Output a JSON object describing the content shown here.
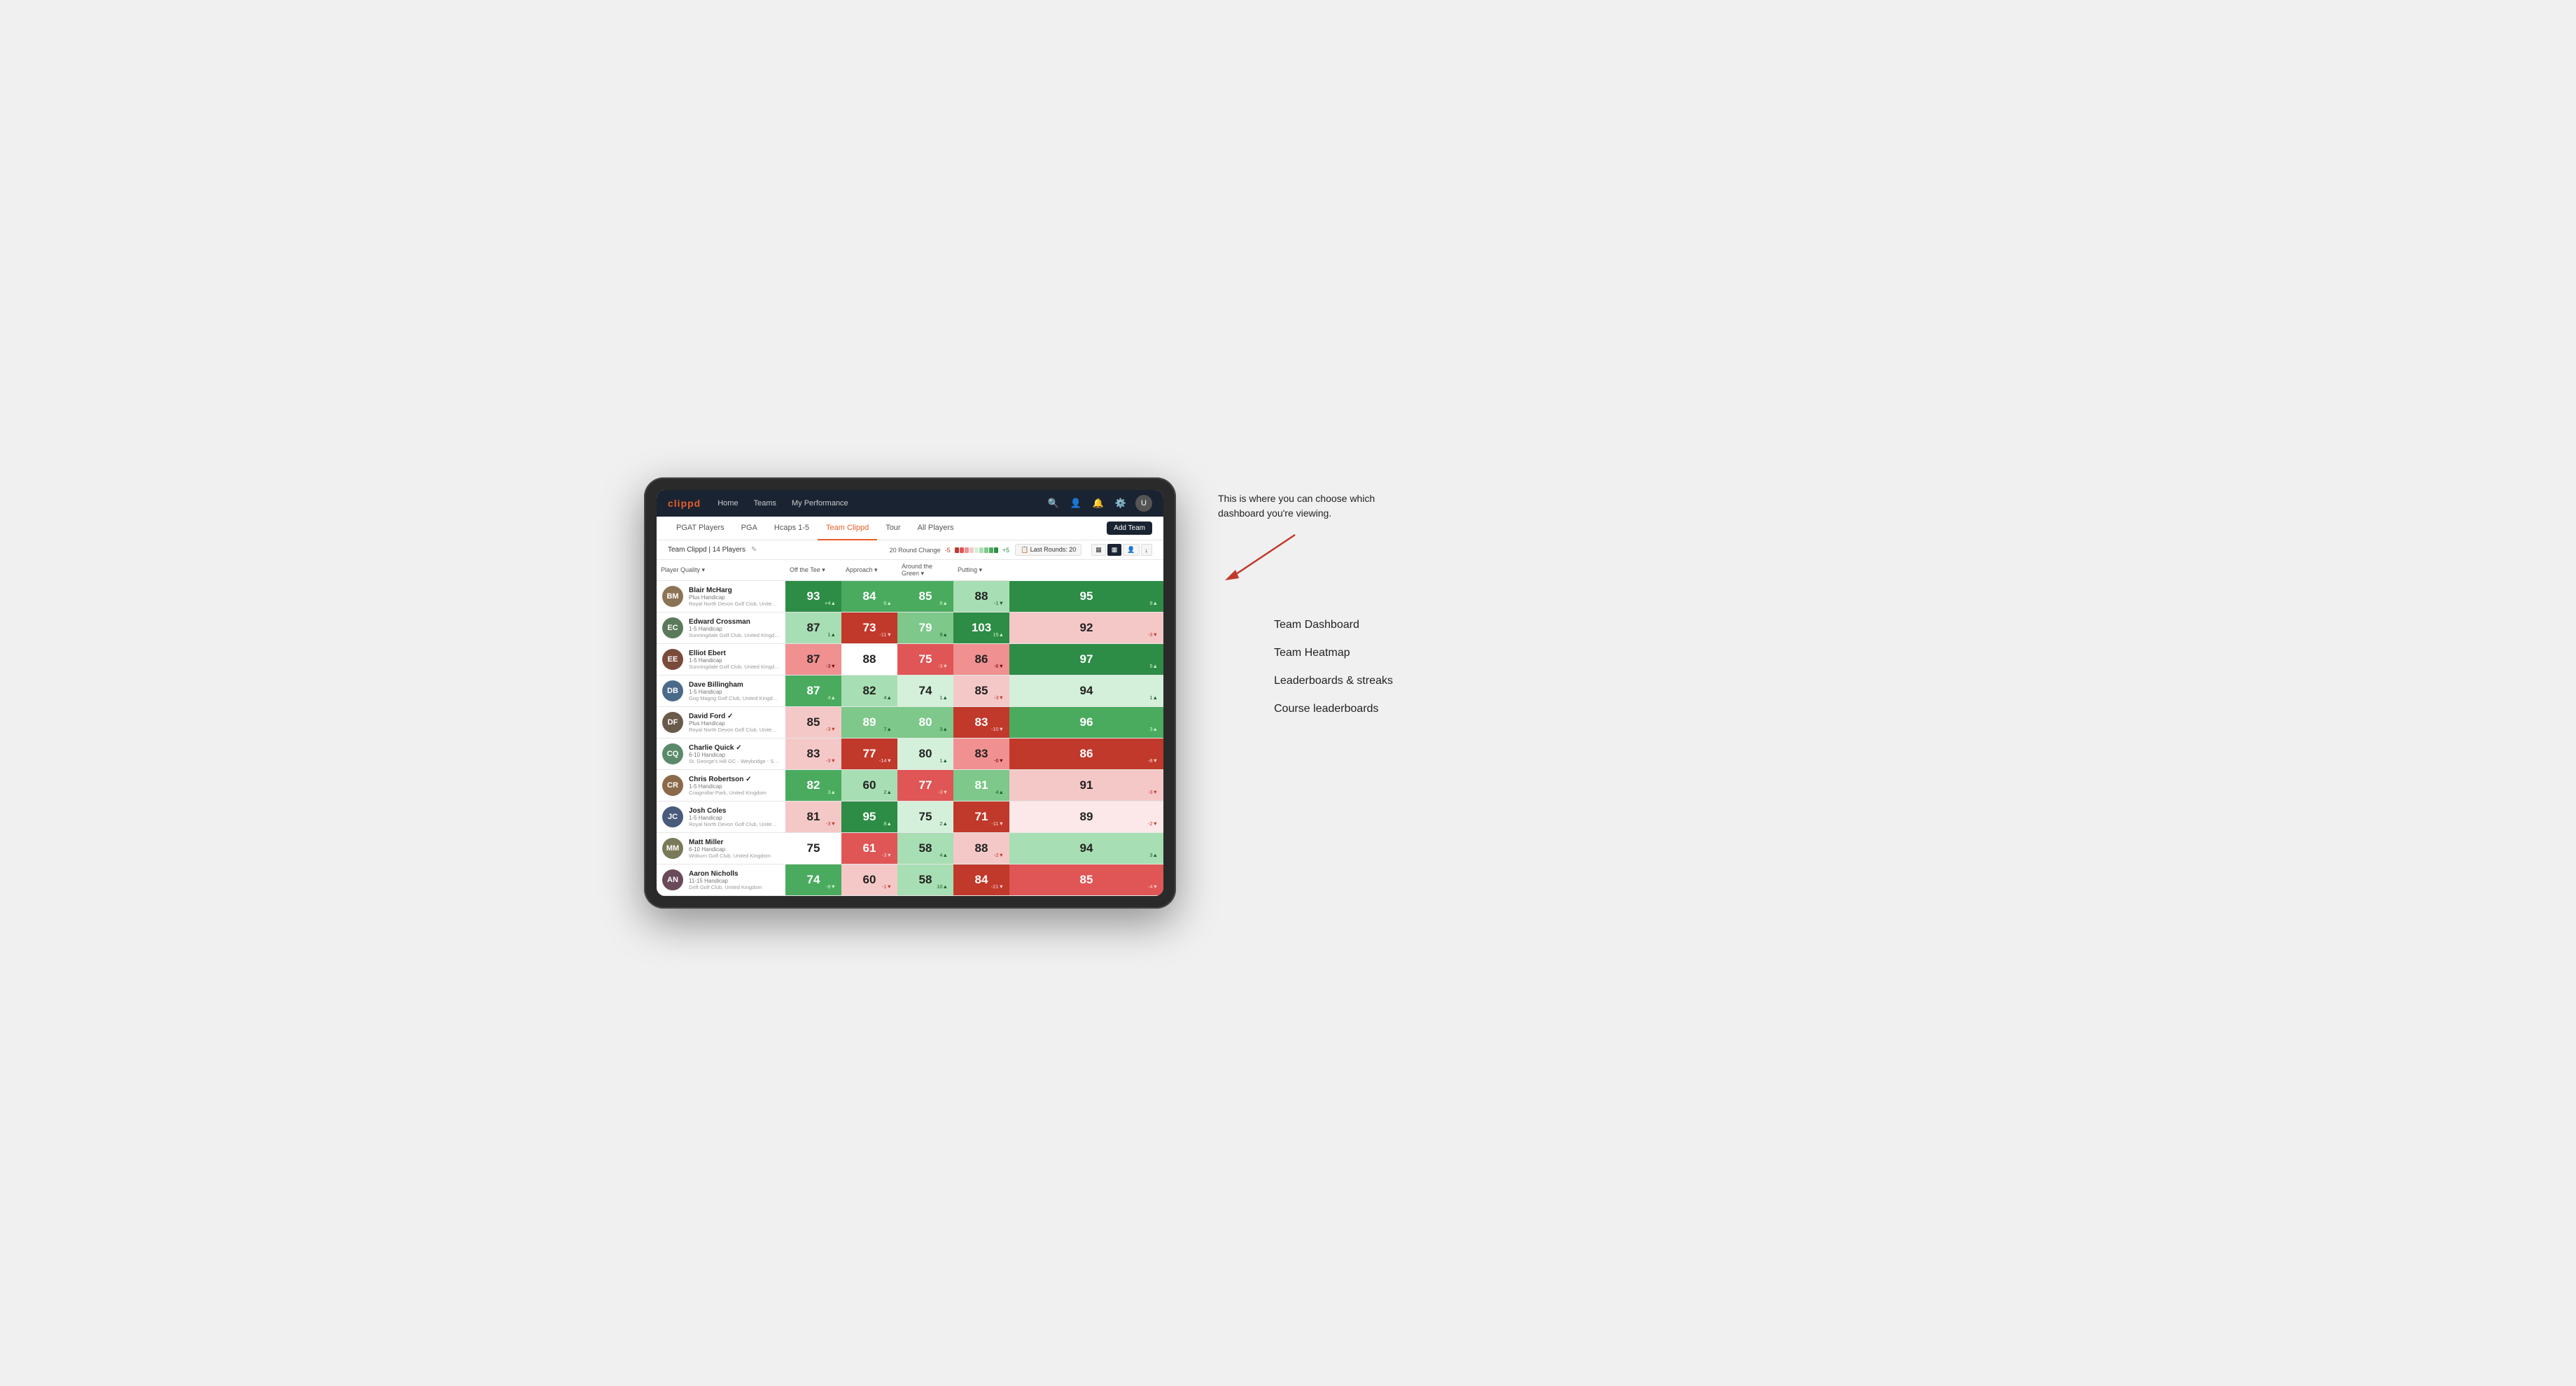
{
  "annotation": {
    "intro_text": "This is where you can choose which dashboard you're viewing.",
    "options": [
      "Team Dashboard",
      "Team Heatmap",
      "Leaderboards & streaks",
      "Course leaderboards"
    ]
  },
  "nav": {
    "logo": "clippd",
    "links": [
      "Home",
      "Teams",
      "My Performance"
    ],
    "icons": [
      "search",
      "user",
      "bell",
      "settings",
      "avatar"
    ]
  },
  "sub_nav": {
    "items": [
      "PGAT Players",
      "PGA",
      "Hcaps 1-5",
      "Team Clippd",
      "Tour",
      "All Players"
    ],
    "active": "Team Clippd",
    "add_button": "Add Team"
  },
  "team_bar": {
    "team_name": "Team Clippd",
    "player_count": "14 Players",
    "round_change_label": "20 Round Change",
    "round_change_neg": "-5",
    "round_change_pos": "+5",
    "last_rounds_label": "Last Rounds:",
    "last_rounds_value": "20"
  },
  "table": {
    "headers": {
      "player": "Player Quality ▾",
      "off_tee": "Off the Tee ▾",
      "approach": "Approach ▾",
      "around_green": "Around the Green ▾",
      "putting": "Putting ▾"
    },
    "players": [
      {
        "name": "Blair McHarg",
        "handicap": "Plus Handicap",
        "club": "Royal North Devon Golf Club, United Kingdom",
        "initials": "BM",
        "avatar_color": "#8B7355",
        "scores": {
          "quality": {
            "val": 93,
            "change": "+4",
            "dir": "up",
            "bg": "green-dark"
          },
          "off_tee": {
            "val": 84,
            "change": "6",
            "dir": "up",
            "bg": "green-mid"
          },
          "approach": {
            "val": 85,
            "change": "8",
            "dir": "up",
            "bg": "green-mid"
          },
          "around_green": {
            "val": 88,
            "change": "-1",
            "dir": "down",
            "bg": "green-pale"
          },
          "putting": {
            "val": 95,
            "change": "9",
            "dir": "up",
            "bg": "green-dark"
          }
        }
      },
      {
        "name": "Edward Crossman",
        "handicap": "1-5 Handicap",
        "club": "Sunningdale Golf Club, United Kingdom",
        "initials": "EC",
        "avatar_color": "#5a7a5a",
        "scores": {
          "quality": {
            "val": 87,
            "change": "1",
            "dir": "up",
            "bg": "green-pale"
          },
          "off_tee": {
            "val": 73,
            "change": "-11",
            "dir": "down",
            "bg": "red-dark"
          },
          "approach": {
            "val": 79,
            "change": "9",
            "dir": "up",
            "bg": "green-light"
          },
          "around_green": {
            "val": 103,
            "change": "15",
            "dir": "up",
            "bg": "green-dark"
          },
          "putting": {
            "val": 92,
            "change": "-3",
            "dir": "down",
            "bg": "red-pale"
          }
        }
      },
      {
        "name": "Elliot Ebert",
        "handicap": "1-5 Handicap",
        "club": "Sunningdale Golf Club, United Kingdom",
        "initials": "EE",
        "avatar_color": "#7a4a3a",
        "scores": {
          "quality": {
            "val": 87,
            "change": "-3",
            "dir": "down",
            "bg": "red-light"
          },
          "off_tee": {
            "val": 88,
            "change": "",
            "dir": "neutral",
            "bg": "white"
          },
          "approach": {
            "val": 75,
            "change": "-3",
            "dir": "down",
            "bg": "red-mid"
          },
          "around_green": {
            "val": 86,
            "change": "-6",
            "dir": "down",
            "bg": "red-light"
          },
          "putting": {
            "val": 97,
            "change": "5",
            "dir": "up",
            "bg": "green-dark"
          }
        }
      },
      {
        "name": "Dave Billingham",
        "handicap": "1-5 Handicap",
        "club": "Gog Magog Golf Club, United Kingdom",
        "initials": "DB",
        "avatar_color": "#4a6a8a",
        "scores": {
          "quality": {
            "val": 87,
            "change": "4",
            "dir": "up",
            "bg": "green-mid"
          },
          "off_tee": {
            "val": 82,
            "change": "4",
            "dir": "up",
            "bg": "green-pale"
          },
          "approach": {
            "val": 74,
            "change": "1",
            "dir": "up",
            "bg": "green-very-pale"
          },
          "around_green": {
            "val": 85,
            "change": "-3",
            "dir": "down",
            "bg": "red-pale"
          },
          "putting": {
            "val": 94,
            "change": "1",
            "dir": "up",
            "bg": "green-very-pale"
          }
        }
      },
      {
        "name": "David Ford",
        "handicap": "Plus Handicap",
        "club": "Royal North Devon Golf Club, United Kingdom",
        "initials": "DF",
        "avatar_color": "#6a5a4a",
        "verified": true,
        "scores": {
          "quality": {
            "val": 85,
            "change": "-3",
            "dir": "down",
            "bg": "red-pale"
          },
          "off_tee": {
            "val": 89,
            "change": "7",
            "dir": "up",
            "bg": "green-light"
          },
          "approach": {
            "val": 80,
            "change": "3",
            "dir": "up",
            "bg": "green-light"
          },
          "around_green": {
            "val": 83,
            "change": "-10",
            "dir": "down",
            "bg": "red-dark"
          },
          "putting": {
            "val": 96,
            "change": "3",
            "dir": "up",
            "bg": "green-mid"
          }
        }
      },
      {
        "name": "Charlie Quick",
        "handicap": "6-10 Handicap",
        "club": "St. George's Hill GC - Weybridge - Surrey, Uni...",
        "initials": "CQ",
        "avatar_color": "#5a8a6a",
        "verified": true,
        "scores": {
          "quality": {
            "val": 83,
            "change": "-3",
            "dir": "down",
            "bg": "red-pale"
          },
          "off_tee": {
            "val": 77,
            "change": "-14",
            "dir": "down",
            "bg": "red-dark"
          },
          "approach": {
            "val": 80,
            "change": "1",
            "dir": "up",
            "bg": "green-very-pale"
          },
          "around_green": {
            "val": 83,
            "change": "-6",
            "dir": "down",
            "bg": "red-light"
          },
          "putting": {
            "val": 86,
            "change": "-8",
            "dir": "down",
            "bg": "red-dark"
          }
        }
      },
      {
        "name": "Chris Robertson",
        "handicap": "1-5 Handicap",
        "club": "Craigmillar Park, United Kingdom",
        "initials": "CR",
        "avatar_color": "#8a6a4a",
        "verified": true,
        "scores": {
          "quality": {
            "val": 82,
            "change": "3",
            "dir": "up",
            "bg": "green-mid"
          },
          "off_tee": {
            "val": 60,
            "change": "2",
            "dir": "up",
            "bg": "green-pale"
          },
          "approach": {
            "val": 77,
            "change": "-3",
            "dir": "down",
            "bg": "red-mid"
          },
          "around_green": {
            "val": 81,
            "change": "4",
            "dir": "up",
            "bg": "green-light"
          },
          "putting": {
            "val": 91,
            "change": "-3",
            "dir": "down",
            "bg": "red-pale"
          }
        }
      },
      {
        "name": "Josh Coles",
        "handicap": "1-5 Handicap",
        "club": "Royal North Devon Golf Club, United Kingdom",
        "initials": "JC",
        "avatar_color": "#4a5a7a",
        "scores": {
          "quality": {
            "val": 81,
            "change": "-3",
            "dir": "down",
            "bg": "red-pale"
          },
          "off_tee": {
            "val": 95,
            "change": "8",
            "dir": "up",
            "bg": "green-dark"
          },
          "approach": {
            "val": 75,
            "change": "2",
            "dir": "up",
            "bg": "green-very-pale"
          },
          "around_green": {
            "val": 71,
            "change": "-11",
            "dir": "down",
            "bg": "red-dark"
          },
          "putting": {
            "val": 89,
            "change": "-2",
            "dir": "down",
            "bg": "red-very-pale"
          }
        }
      },
      {
        "name": "Matt Miller",
        "handicap": "6-10 Handicap",
        "club": "Woburn Golf Club, United Kingdom",
        "initials": "MM",
        "avatar_color": "#7a7a5a",
        "scores": {
          "quality": {
            "val": 75,
            "change": "",
            "dir": "neutral",
            "bg": "white"
          },
          "off_tee": {
            "val": 61,
            "change": "-3",
            "dir": "down",
            "bg": "red-mid"
          },
          "approach": {
            "val": 58,
            "change": "4",
            "dir": "up",
            "bg": "green-pale"
          },
          "around_green": {
            "val": 88,
            "change": "-2",
            "dir": "down",
            "bg": "red-pale"
          },
          "putting": {
            "val": 94,
            "change": "3",
            "dir": "up",
            "bg": "green-pale"
          }
        }
      },
      {
        "name": "Aaron Nicholls",
        "handicap": "11-15 Handicap",
        "club": "Drift Golf Club, United Kingdom",
        "initials": "AN",
        "avatar_color": "#6a4a5a",
        "scores": {
          "quality": {
            "val": 74,
            "change": "-8",
            "dir": "down",
            "bg": "green-mid"
          },
          "off_tee": {
            "val": 60,
            "change": "-1",
            "dir": "down",
            "bg": "red-pale"
          },
          "approach": {
            "val": 58,
            "change": "10",
            "dir": "up",
            "bg": "green-pale"
          },
          "around_green": {
            "val": 84,
            "change": "-21",
            "dir": "down",
            "bg": "red-dark"
          },
          "putting": {
            "val": 85,
            "change": "-4",
            "dir": "down",
            "bg": "red-mid"
          }
        }
      }
    ]
  },
  "colors": {
    "green_dark": "#2d8c45",
    "green_mid": "#4aab5f",
    "green_light": "#7dc88a",
    "green_pale": "#a8deb3",
    "green_very_pale": "#d4f0da",
    "white": "#ffffff",
    "red_very_pale": "#fce8e8",
    "red_pale": "#f5c8c8",
    "red_light": "#f09090",
    "red_mid": "#e05555",
    "red_dark": "#c0392b"
  }
}
